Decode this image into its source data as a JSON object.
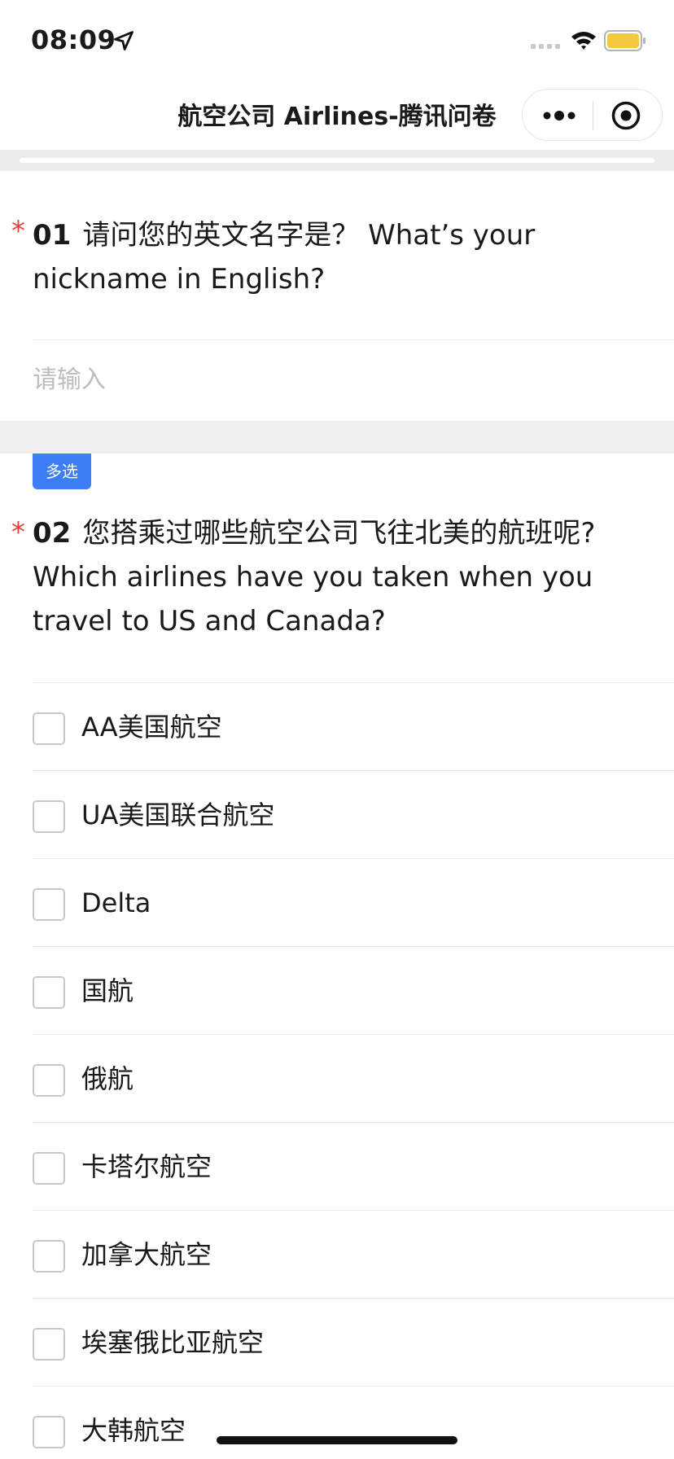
{
  "status_bar": {
    "time": "08:09",
    "icons": [
      "location-arrow-icon",
      "signal-icon",
      "wifi-icon",
      "battery-icon"
    ],
    "battery_color": "#f5c842"
  },
  "nav": {
    "title": "航空公司 Airlines-腾讯问卷",
    "capsule_icons": [
      "more-dots-icon",
      "target-icon"
    ]
  },
  "questions": {
    "q1": {
      "required_mark": "*",
      "number": "01",
      "text_line1": "请问您的英文名字是？ What’s your",
      "text_line2": "nickname in English?",
      "input_placeholder": "请输入",
      "input_value": ""
    },
    "q2": {
      "badge": "多选",
      "required_mark": "*",
      "number": "02",
      "text_line1": "您搭乘过哪些航空公司飞往北美的航班呢?",
      "text_line2": "Which airlines have you taken when you",
      "text_line3": "travel to US and Canada?",
      "options": [
        {
          "label": "AA美国航空",
          "checked": false
        },
        {
          "label": "UA美国联合航空",
          "checked": false
        },
        {
          "label": "Delta",
          "checked": false
        },
        {
          "label": "国航",
          "checked": false
        },
        {
          "label": "俄航",
          "checked": false
        },
        {
          "label": "卡塔尔航空",
          "checked": false
        },
        {
          "label": "加拿大航空",
          "checked": false
        },
        {
          "label": "埃塞俄比亚航空",
          "checked": false
        },
        {
          "label": "大韩航空",
          "checked": false
        }
      ]
    }
  },
  "colors": {
    "accent": "#3d7df5",
    "required": "#e0453a",
    "divider": "#e8e8e8",
    "section_bg": "#f0f0f0"
  }
}
